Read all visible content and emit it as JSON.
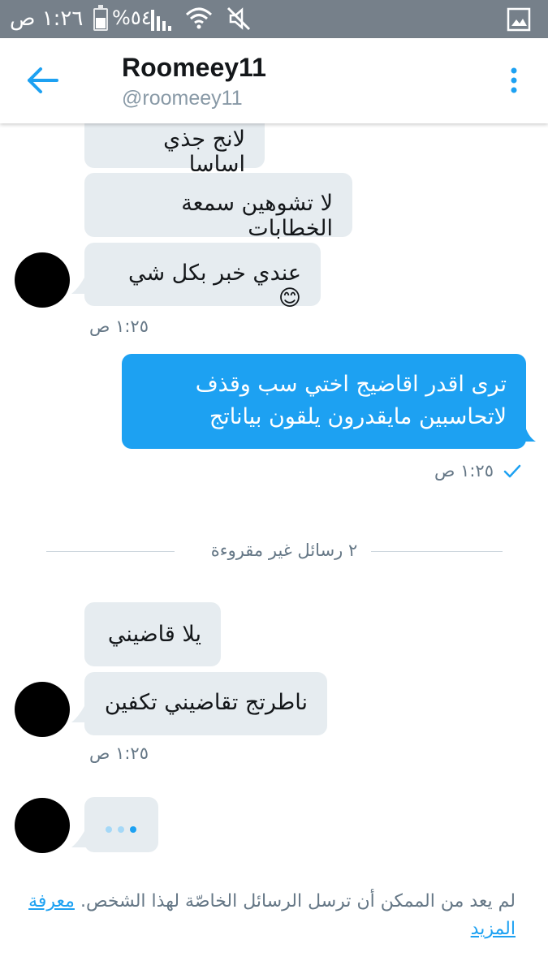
{
  "status_bar": {
    "time": "١:٢٦ ص",
    "battery_percent": "%٥٤",
    "battery_level": 0.54,
    "icons": [
      "battery-icon",
      "signal-icon",
      "wifi-icon",
      "mute-icon",
      "gallery-icon"
    ]
  },
  "header": {
    "name": "Roomeey11",
    "handle": "@roomeey11",
    "back_icon": "back-arrow-icon",
    "menu_icon": "more-vertical-icon"
  },
  "messages": [
    {
      "direction": "received",
      "text": "لانج جذي اساسا"
    },
    {
      "direction": "received",
      "text": "لا تشوهين سمعة الخطابات"
    },
    {
      "direction": "received",
      "text": "عندي خبر بكل شي 😊"
    },
    {
      "direction": "received_time",
      "text": "١:٢٥ ص"
    },
    {
      "direction": "sent",
      "lines": [
        "ترى اقدر اقاضيج اختي سب وقذف",
        "لاتحاسبين مايقدرون يلقون بياناتج"
      ]
    },
    {
      "direction": "sent_time",
      "text": "١:٢٥ ص"
    },
    {
      "direction": "received",
      "text": "يلا قاضيني"
    },
    {
      "direction": "received",
      "text": "ناطرتج تقاضيني تكفين"
    },
    {
      "direction": "received_time",
      "text": "١:٢٥ ص"
    }
  ],
  "unread_divider": "٢ رسائل غير مقروءة",
  "notice": {
    "text": "لم يعد من الممكن أن ترسل الرسائل الخاصّة لهذا الشخص.",
    "link": "معرفة المزيد"
  },
  "colors": {
    "accent": "#1da1f2",
    "received_bubble": "#e6ecf0",
    "status_bar": "#76808a"
  }
}
